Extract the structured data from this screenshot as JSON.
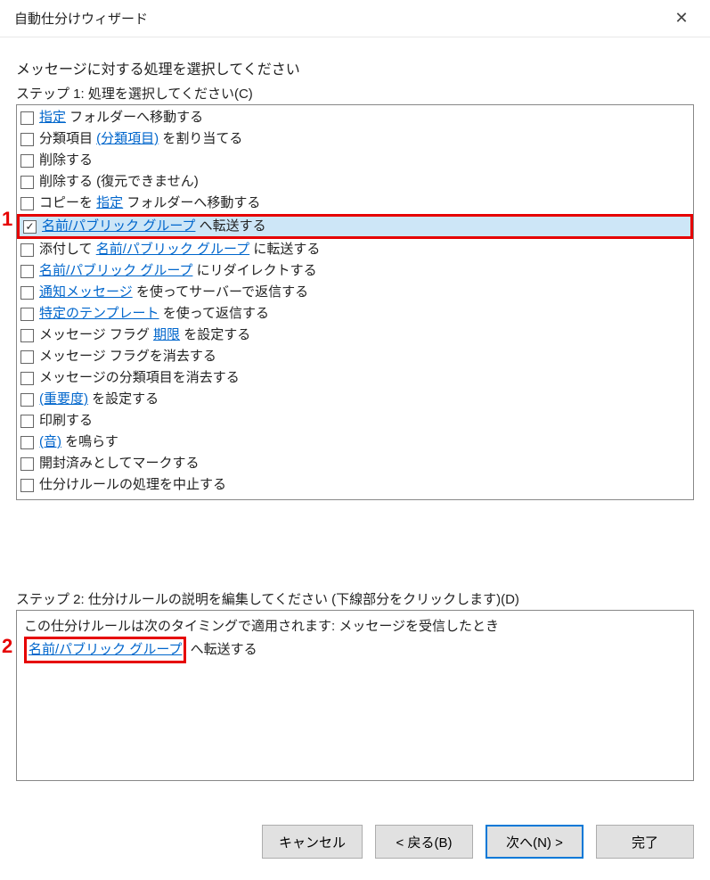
{
  "title": "自動仕分けウィザード",
  "instruction": "メッセージに対する処理を選択してください",
  "step1_label": "ステップ 1: 処理を選択してください(C)",
  "step2_label": "ステップ 2: 仕分けルールの説明を編集してください (下線部分をクリックします)(D)",
  "markers": {
    "one": "1",
    "two": "2"
  },
  "actions": [
    {
      "checked": false,
      "selected": false,
      "highlighted": false,
      "parts": [
        {
          "t": "link",
          "v": "指定"
        },
        {
          "t": "text",
          "v": " フォルダーへ移動する"
        }
      ]
    },
    {
      "checked": false,
      "selected": false,
      "highlighted": false,
      "parts": [
        {
          "t": "text",
          "v": "分類項目 "
        },
        {
          "t": "link",
          "v": "(分類項目)"
        },
        {
          "t": "text",
          "v": " を割り当てる"
        }
      ]
    },
    {
      "checked": false,
      "selected": false,
      "highlighted": false,
      "parts": [
        {
          "t": "text",
          "v": "削除する"
        }
      ]
    },
    {
      "checked": false,
      "selected": false,
      "highlighted": false,
      "parts": [
        {
          "t": "text",
          "v": "削除する (復元できません)"
        }
      ]
    },
    {
      "checked": false,
      "selected": false,
      "highlighted": false,
      "parts": [
        {
          "t": "text",
          "v": "コピーを "
        },
        {
          "t": "link",
          "v": "指定"
        },
        {
          "t": "text",
          "v": " フォルダーへ移動する"
        }
      ]
    },
    {
      "checked": true,
      "selected": true,
      "highlighted": true,
      "parts": [
        {
          "t": "link",
          "v": "名前/パブリック グループ"
        },
        {
          "t": "text",
          "v": " へ転送する"
        }
      ]
    },
    {
      "checked": false,
      "selected": false,
      "highlighted": false,
      "parts": [
        {
          "t": "text",
          "v": "添付して "
        },
        {
          "t": "link",
          "v": "名前/パブリック グループ"
        },
        {
          "t": "text",
          "v": " に転送する"
        }
      ]
    },
    {
      "checked": false,
      "selected": false,
      "highlighted": false,
      "parts": [
        {
          "t": "link",
          "v": "名前/パブリック グループ"
        },
        {
          "t": "text",
          "v": " にリダイレクトする"
        }
      ]
    },
    {
      "checked": false,
      "selected": false,
      "highlighted": false,
      "parts": [
        {
          "t": "link",
          "v": "通知メッセージ"
        },
        {
          "t": "text",
          "v": " を使ってサーバーで返信する"
        }
      ]
    },
    {
      "checked": false,
      "selected": false,
      "highlighted": false,
      "parts": [
        {
          "t": "link",
          "v": "特定のテンプレート"
        },
        {
          "t": "text",
          "v": " を使って返信する"
        }
      ]
    },
    {
      "checked": false,
      "selected": false,
      "highlighted": false,
      "parts": [
        {
          "t": "text",
          "v": "メッセージ フラグ "
        },
        {
          "t": "link",
          "v": "期限"
        },
        {
          "t": "text",
          "v": " を設定する"
        }
      ]
    },
    {
      "checked": false,
      "selected": false,
      "highlighted": false,
      "parts": [
        {
          "t": "text",
          "v": "メッセージ フラグを消去する"
        }
      ]
    },
    {
      "checked": false,
      "selected": false,
      "highlighted": false,
      "parts": [
        {
          "t": "text",
          "v": "メッセージの分類項目を消去する"
        }
      ]
    },
    {
      "checked": false,
      "selected": false,
      "highlighted": false,
      "parts": [
        {
          "t": "link",
          "v": "(重要度)"
        },
        {
          "t": "text",
          "v": " を設定する"
        }
      ]
    },
    {
      "checked": false,
      "selected": false,
      "highlighted": false,
      "parts": [
        {
          "t": "text",
          "v": "印刷する"
        }
      ]
    },
    {
      "checked": false,
      "selected": false,
      "highlighted": false,
      "parts": [
        {
          "t": "link",
          "v": "(音)"
        },
        {
          "t": "text",
          "v": " を鳴らす"
        }
      ]
    },
    {
      "checked": false,
      "selected": false,
      "highlighted": false,
      "parts": [
        {
          "t": "text",
          "v": "開封済みとしてマークする"
        }
      ]
    },
    {
      "checked": false,
      "selected": false,
      "highlighted": false,
      "parts": [
        {
          "t": "text",
          "v": "仕分けルールの処理を中止する"
        }
      ]
    }
  ],
  "description": {
    "line1": "この仕分けルールは次のタイミングで適用されます: メッセージを受信したとき",
    "line2_link": "名前/パブリック グループ",
    "line2_after": " へ転送する"
  },
  "buttons": {
    "cancel": "キャンセル",
    "back": "< 戻る(B)",
    "next": "次へ(N) >",
    "finish": "完了"
  }
}
